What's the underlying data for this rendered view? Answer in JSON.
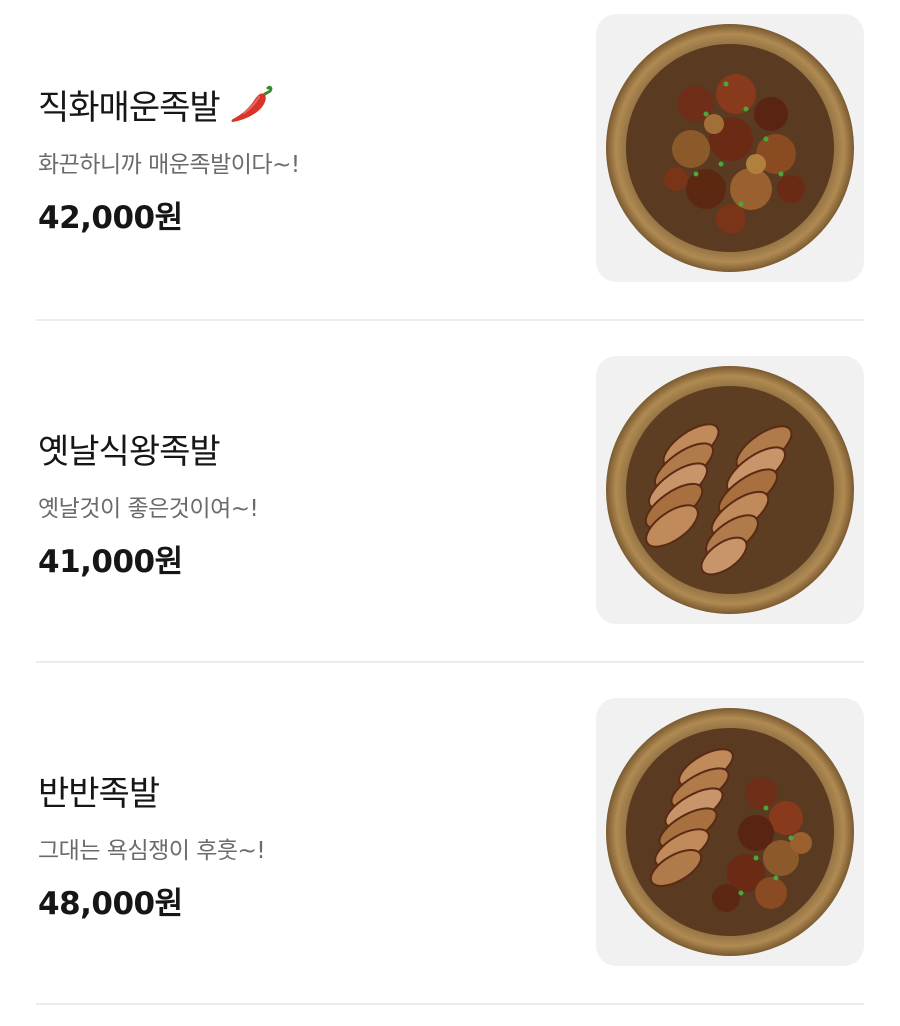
{
  "menu": {
    "items": [
      {
        "name": "직화매운족발",
        "description": "화끈하니까 매운족발이다~!",
        "price": "42,000원",
        "badge_icon": "chili-pepper-icon",
        "image": "spicy-jokbal-photo"
      },
      {
        "name": "옛날식왕족발",
        "description": "옛날것이 좋은것이여~!",
        "price": "41,000원",
        "image": "classic-jokbal-photo"
      },
      {
        "name": "반반족발",
        "description": "그대는 욕심쟁이 후훗~!",
        "price": "48,000원",
        "image": "half-half-jokbal-photo"
      }
    ]
  },
  "colors": {
    "title": "#161616",
    "description": "#6b6b6b",
    "price": "#161616",
    "divider": "#ececec",
    "thumb_bg": "#f1f1f1",
    "plate": "#9a7440",
    "pepper": "#d8342a"
  }
}
